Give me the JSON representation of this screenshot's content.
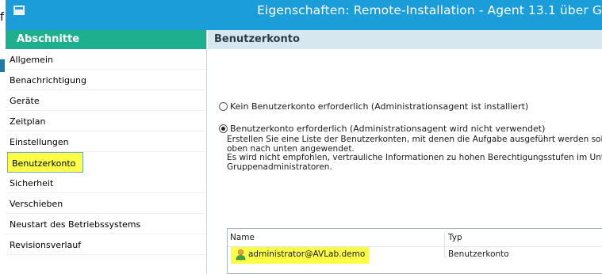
{
  "window": {
    "title": "Eigenschaften: Remote-Installation - Agent 13.1 über G",
    "fragment_letter": "f",
    "title_bar_color": "#1a9dd8"
  },
  "sidebar": {
    "header": "Abschnitte",
    "header_color": "#1daf8e",
    "items": [
      {
        "label": "Allgemein"
      },
      {
        "label": "Benachrichtigung"
      },
      {
        "label": "Geräte"
      },
      {
        "label": "Zeitplan"
      },
      {
        "label": "Einstellungen"
      },
      {
        "label": "Benutzerkonto"
      },
      {
        "label": "Sicherheit"
      },
      {
        "label": "Verschieben"
      },
      {
        "label": "Neustart des Betriebssystems"
      },
      {
        "label": "Revisionsverlauf"
      }
    ],
    "selected": "Benutzerkonto"
  },
  "main": {
    "header": "Benutzerkonto",
    "options": [
      {
        "label": "Kein Benutzerkonto erforderlich (Administrationsagent ist installiert)",
        "checked": false
      },
      {
        "label": "Benutzerkonto erforderlich (Administrationsagent wird nicht verwendet)",
        "checked": true
      }
    ],
    "description_lines": [
      "Erstellen Sie eine Liste der Benutzerkonten, mit denen die Aufgabe ausgeführt werden soll.",
      "oben nach unten angewendet.",
      "Es wird nicht empfohlen, vertrauliche Informationen zu hohen Berechtigungsstufen im Unte",
      "Gruppenadministratoren."
    ],
    "table": {
      "columns": [
        "Name",
        "Typ"
      ],
      "rows": [
        {
          "name": "administrator@AVLab.demo",
          "type": "Benutzerkonto",
          "icon": "user-icon"
        }
      ]
    },
    "highlight_color": "#fbff45"
  }
}
